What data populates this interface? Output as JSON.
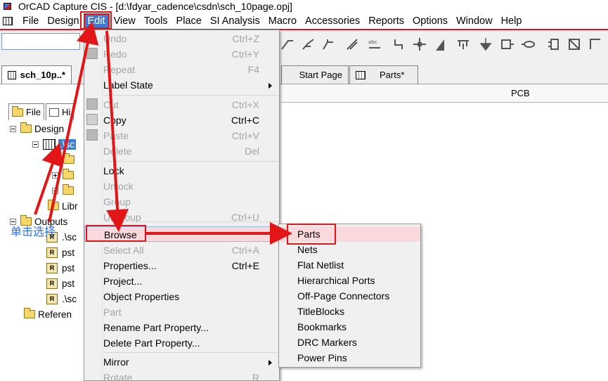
{
  "window": {
    "title": "OrCAD Capture CIS - [d:\\fdyar_cadence\\csdn\\sch_10page.opj]"
  },
  "menubar": {
    "items": [
      "File",
      "Design",
      "Edit",
      "View",
      "Tools",
      "Place",
      "SI Analysis",
      "Macro",
      "Accessories",
      "Reports",
      "Options",
      "Window",
      "Help"
    ],
    "active": "Edit"
  },
  "tabs": [
    {
      "label": "sch_10p..*"
    },
    {
      "label": "Start Page"
    },
    {
      "label": "Parts*"
    }
  ],
  "pcb_header": "PCB",
  "project_pane": {
    "tab_file": "File",
    "tab_hierarchy": "Hi",
    "tree": [
      {
        "label": "Design"
      },
      {
        "label": ".\\sc"
      },
      {
        "label": ""
      },
      {
        "label": ""
      },
      {
        "label": ""
      },
      {
        "label": "Libr"
      },
      {
        "label": "Outputs"
      },
      {
        "label": ".\\sc"
      },
      {
        "label": "pst"
      },
      {
        "label": "pst"
      },
      {
        "label": "pst"
      },
      {
        "label": ".\\sc"
      },
      {
        "label": "Referen"
      }
    ]
  },
  "edit_menu": {
    "items": [
      {
        "label": "Undo",
        "shortcut": "Ctrl+Z",
        "enabled": false
      },
      {
        "label": "Redo",
        "shortcut": "Ctrl+Y",
        "enabled": false
      },
      {
        "label": "Repeat",
        "shortcut": "F4",
        "enabled": false
      },
      {
        "label": "Label State",
        "shortcut": "",
        "enabled": true
      },
      {
        "label": "Cut",
        "shortcut": "Ctrl+X",
        "enabled": false
      },
      {
        "label": "Copy",
        "shortcut": "Ctrl+C",
        "enabled": true
      },
      {
        "label": "Paste",
        "shortcut": "Ctrl+V",
        "enabled": false
      },
      {
        "label": "Delete",
        "shortcut": "Del",
        "enabled": false
      },
      {
        "label": "Lock",
        "shortcut": "",
        "enabled": true
      },
      {
        "label": "Unlock",
        "shortcut": "",
        "enabled": false
      },
      {
        "label": "Group",
        "shortcut": "",
        "enabled": false
      },
      {
        "label": "Ungroup",
        "shortcut": "Ctrl+U",
        "enabled": false
      },
      {
        "label": "Browse",
        "shortcut": "",
        "enabled": true
      },
      {
        "label": "Select All",
        "shortcut": "Ctrl+A",
        "enabled": false
      },
      {
        "label": "Properties...",
        "shortcut": "Ctrl+E",
        "enabled": true
      },
      {
        "label": "Project...",
        "shortcut": "",
        "enabled": true
      },
      {
        "label": "Object Properties",
        "shortcut": "",
        "enabled": true
      },
      {
        "label": "Part",
        "shortcut": "",
        "enabled": false
      },
      {
        "label": "Rename Part Property...",
        "shortcut": "",
        "enabled": true
      },
      {
        "label": "Delete Part Property...",
        "shortcut": "",
        "enabled": true
      },
      {
        "label": "Mirror",
        "shortcut": "",
        "enabled": true
      },
      {
        "label": "Rotate",
        "shortcut": "R",
        "enabled": false
      }
    ]
  },
  "browse_submenu": {
    "items": [
      "Parts",
      "Nets",
      "Flat Netlist",
      "Hierarchical Ports",
      "Off-Page Connectors",
      "TitleBlocks",
      "Bookmarks",
      "DRC Markers",
      "Power Pins"
    ]
  },
  "annotation": "单击选择",
  "colors": {
    "highlight": "#e21616",
    "selection": "#3d7bd1",
    "menu_hover": "#f9d9dc",
    "annotation": "#2f6fe4"
  }
}
